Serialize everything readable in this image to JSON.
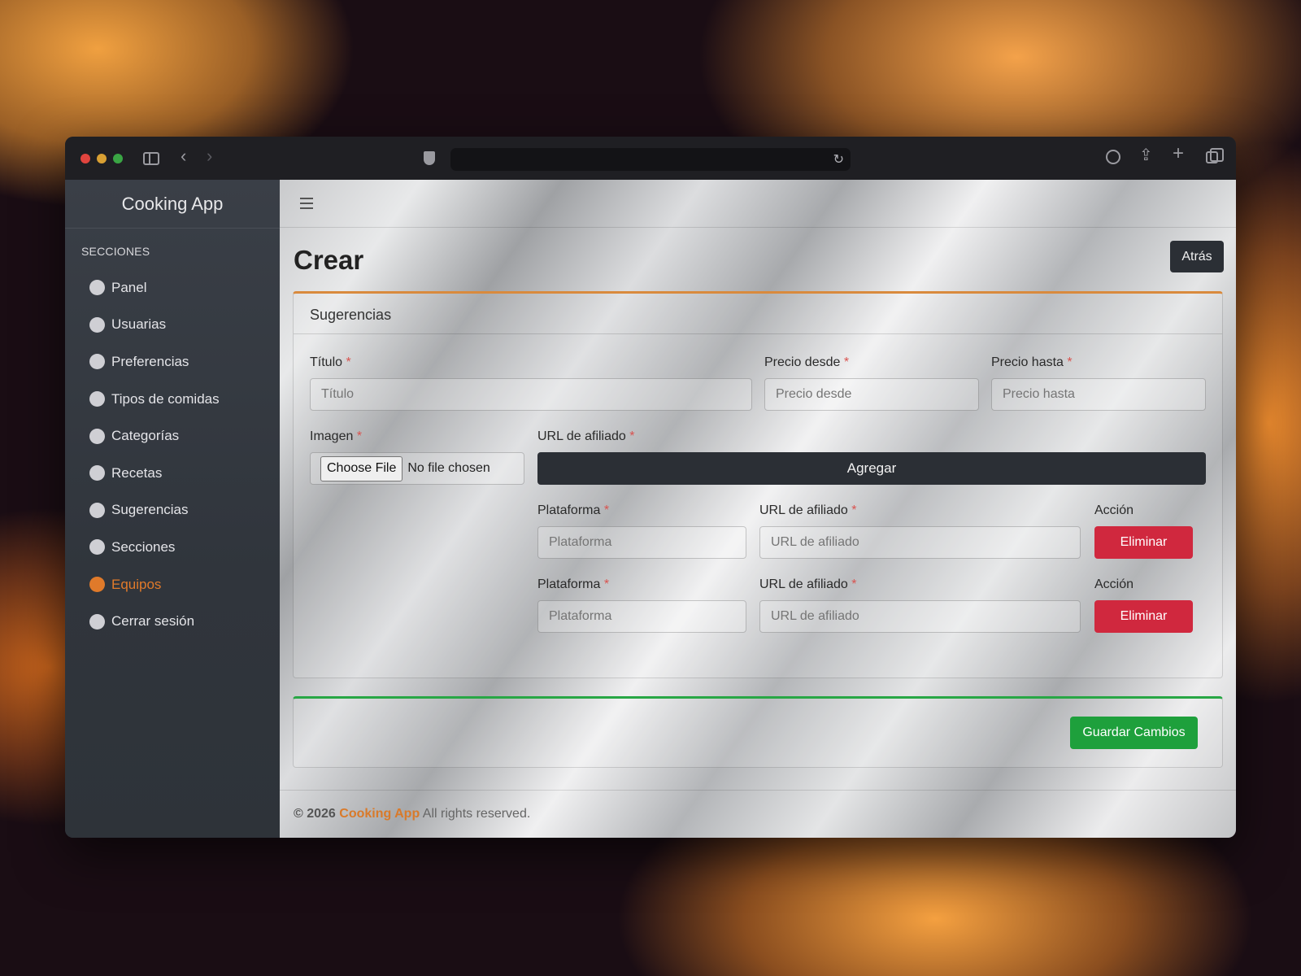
{
  "app": {
    "name": "Cooking App"
  },
  "browser": {
    "address": ""
  },
  "sidebar": {
    "heading": "SECCIONES",
    "items": [
      {
        "label": "Panel",
        "active": false
      },
      {
        "label": "Usuarias",
        "active": false
      },
      {
        "label": "Preferencias",
        "active": false
      },
      {
        "label": "Tipos de comidas",
        "active": false
      },
      {
        "label": "Categorías",
        "active": false
      },
      {
        "label": "Recetas",
        "active": false
      },
      {
        "label": "Sugerencias",
        "active": false
      },
      {
        "label": "Secciones",
        "active": false
      },
      {
        "label": "Equipos",
        "active": true
      },
      {
        "label": "Cerrar sesión",
        "active": false
      }
    ],
    "accent_color": "#e07a2a"
  },
  "page": {
    "title": "Crear",
    "back_label": "Atrás"
  },
  "form": {
    "card_title": "Sugerencias",
    "required_mark": "*",
    "titulo": {
      "label": "Título",
      "placeholder": "Título"
    },
    "precio_desde": {
      "label": "Precio desde",
      "placeholder": "Precio desde"
    },
    "precio_hasta": {
      "label": "Precio hasta",
      "placeholder": "Precio hasta"
    },
    "imagen": {
      "label": "Imagen",
      "button": "Choose File",
      "status": "No file chosen"
    },
    "afiliado": {
      "label": "URL de afiliado",
      "add_label": "Agregar"
    },
    "rows": [
      {
        "plataforma_label": "Plataforma",
        "plataforma_placeholder": "Plataforma",
        "url_label": "URL de afiliado",
        "url_placeholder": "URL de afiliado",
        "accion_label": "Acción",
        "delete_label": "Eliminar"
      },
      {
        "plataforma_label": "Plataforma",
        "plataforma_placeholder": "Plataforma",
        "url_label": "URL de afiliado",
        "url_placeholder": "URL de afiliado",
        "accion_label": "Acción",
        "delete_label": "Eliminar"
      }
    ]
  },
  "save": {
    "label": "Guardar Cambios"
  },
  "footer": {
    "copyright": "© 2026",
    "brand": "Cooking App",
    "rights": "All rights reserved."
  },
  "colors": {
    "primary": "#2b2f35",
    "danger": "#d0283e",
    "success": "#1ea03c",
    "accent": "#d98a3d"
  }
}
